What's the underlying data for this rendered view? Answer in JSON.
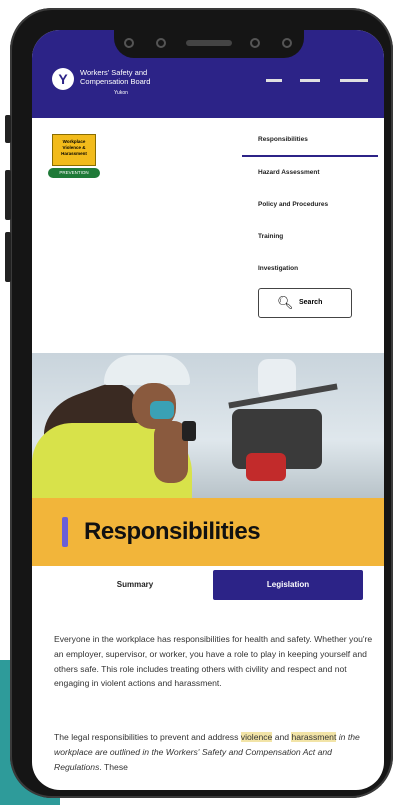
{
  "header": {
    "org_line1": "Workers' Safety and",
    "org_line2": "Compensation Board",
    "org_sub": "Yukon",
    "logo_icon": "wcb-logo-icon"
  },
  "badge": {
    "title": "Workplace Violence & Harassment",
    "ribbon": "PREVENTION"
  },
  "menu": {
    "items": [
      {
        "label": "Responsibilities",
        "active": true
      },
      {
        "label": "Hazard Assessment"
      },
      {
        "label": "Policy and Procedures"
      },
      {
        "label": "Training"
      },
      {
        "label": "Investigation"
      }
    ],
    "search_label": "Search",
    "search_icon": "search-icon"
  },
  "page": {
    "title": "Responsibilities",
    "tabs": [
      {
        "label": "Summary",
        "active": true
      },
      {
        "label": "Legislation"
      }
    ],
    "para1": "Everyone in the workplace has responsibilities for health and safety. Whether you're an employer, supervisor, or worker, you have a role to play in keeping yourself and others safe. This role includes treating others with civility and respect and not engaging in violent actions and harassment.",
    "para2_a": "The legal responsibilities to prevent and address ",
    "para2_link1": "violence",
    "para2_b": " and ",
    "para2_link2": "harassment",
    "para2_c": " in the workplace are outlined in the ",
    "para2_italic": "Workers' Safety and Compensation Act and Regulations",
    "para2_d": ". These"
  },
  "colors": {
    "brand": "#2c2387",
    "accent": "#f2b53a",
    "title_marker": "#6b5fd7",
    "highlight": "#f2e4a7"
  }
}
